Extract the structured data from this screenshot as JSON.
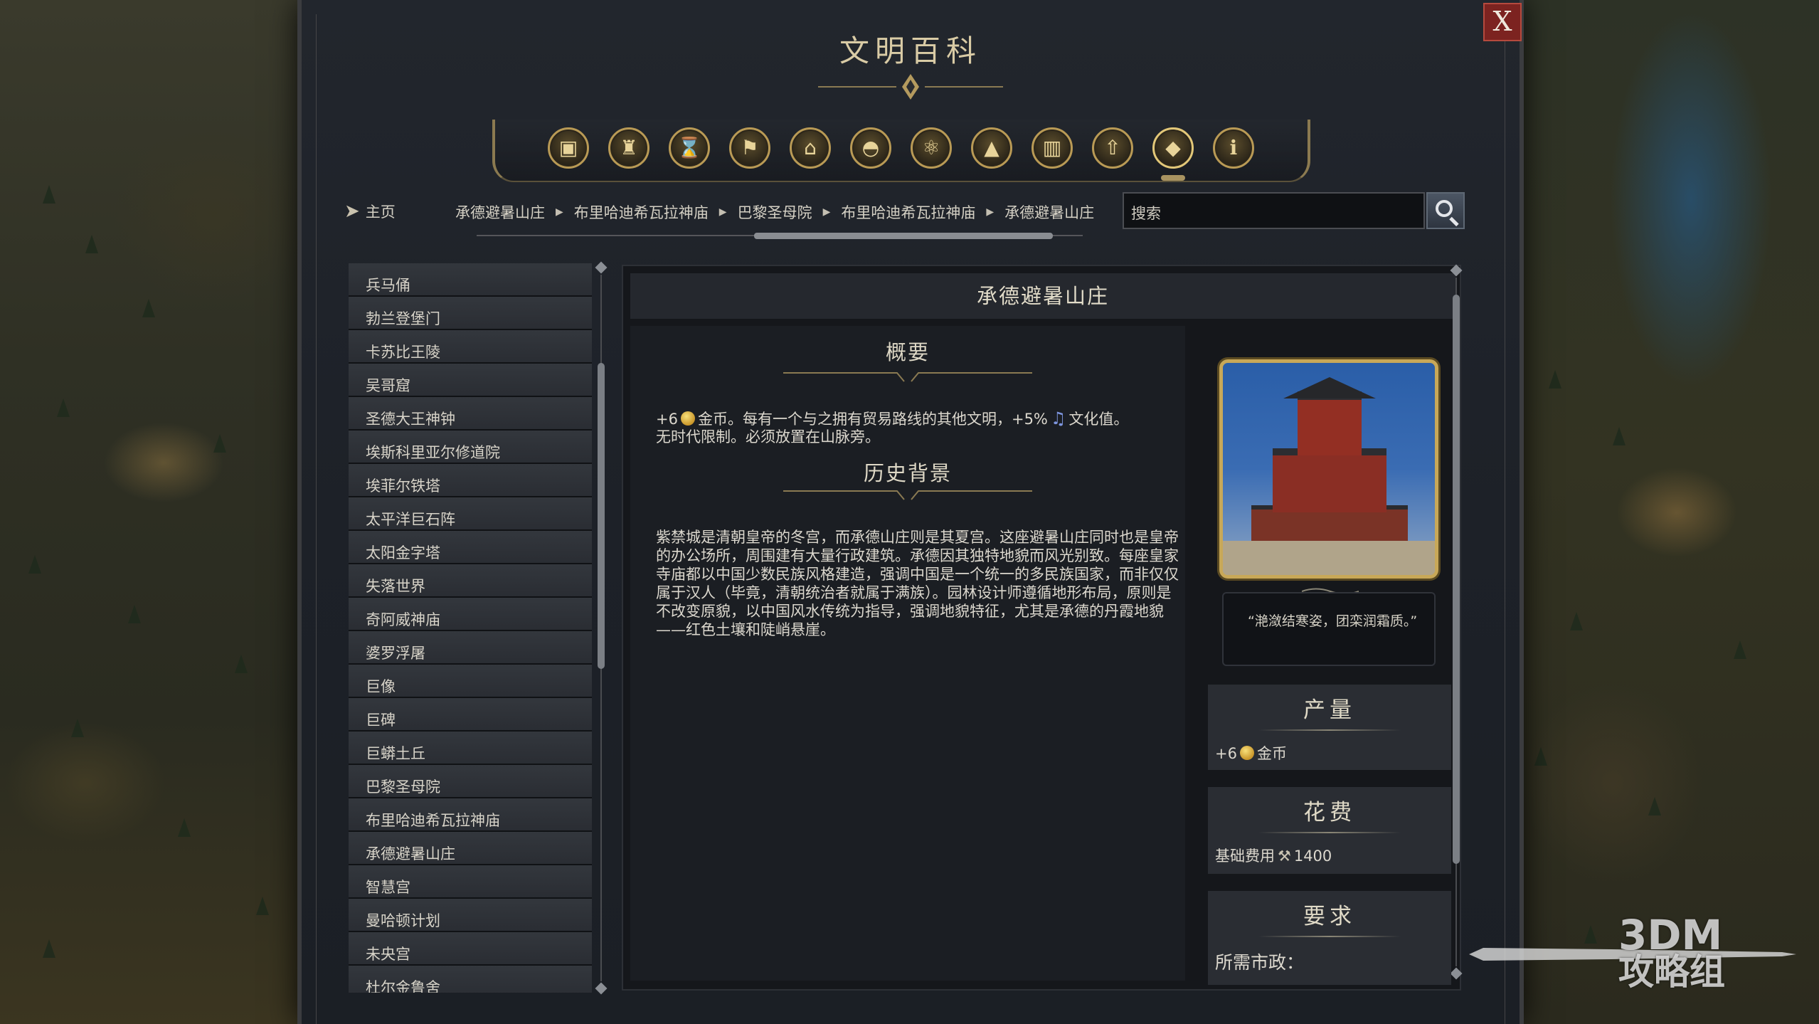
{
  "window": {
    "title": "文明百科",
    "close_label": "X"
  },
  "toolbar": {
    "icons": [
      {
        "name": "resources-icon",
        "glyph": "▣"
      },
      {
        "name": "goblet-icon",
        "glyph": "♜"
      },
      {
        "name": "hourglass-icon",
        "glyph": "⌛"
      },
      {
        "name": "flag-icon",
        "glyph": "⚑"
      },
      {
        "name": "temple-icon",
        "glyph": "⌂"
      },
      {
        "name": "dome-icon",
        "glyph": "◓"
      },
      {
        "name": "atom-icon",
        "glyph": "⚛"
      },
      {
        "name": "mountains-icon",
        "glyph": "▲"
      },
      {
        "name": "buildings-icon",
        "glyph": "▥"
      },
      {
        "name": "upgrade-icon",
        "glyph": "⇧"
      },
      {
        "name": "wonder-icon",
        "glyph": "◆"
      },
      {
        "name": "info-icon",
        "glyph": "ℹ"
      }
    ],
    "active_index": 10
  },
  "nav": {
    "home_label": "主页",
    "breadcrumbs": [
      "承德避暑山庄",
      "布里哈迪希瓦拉神庙",
      "巴黎圣母院",
      "布里哈迪希瓦拉神庙",
      "承德避暑山庄"
    ],
    "search_placeholder": "搜索"
  },
  "list": {
    "items": [
      "兵马俑",
      "勃兰登堡门",
      "卡苏比王陵",
      "吴哥窟",
      "圣德大王神钟",
      "埃斯科里亚尔修道院",
      "埃菲尔铁塔",
      "太平洋巨石阵",
      "太阳金字塔",
      "失落世界",
      "奇阿威神庙",
      "婆罗浮屠",
      "巨像",
      "巨碑",
      "巨蟒土丘",
      "巴黎圣母院",
      "布里哈迪希瓦拉神庙",
      "承德避暑山庄",
      "智慧宫",
      "曼哈顿计划",
      "未央宫",
      "杜尔金鲁舍"
    ]
  },
  "detail": {
    "title": "承德避暑山庄",
    "overview_heading": "概要",
    "overview": {
      "prefix": "+6",
      "gold_label": "金币。每有一个与之拥有贸易路线的其他文明，+5%",
      "culture_label": "文化值。",
      "line2": "无时代限制。必须放置在山脉旁。"
    },
    "history_heading": "历史背景",
    "history_text": "紫禁城是清朝皇帝的冬宫，而承德山庄则是其夏宫。这座避暑山庄同时也是皇帝的办公场所，周围建有大量行政建筑。承德因其独特地貌而风光别致。每座皇家寺庙都以中国少数民族风格建造，强调中国是一个统一的多民族国家，而非仅仅属于汉人（毕竟，清朝统治者就属于满族）。园林设计师遵循地形布局，原则是不改变原貌，以中国风水传统为指导，强调地貌特征，尤其是承德的丹霞地貌——红色土壤和陡峭悬崖。",
    "quote": "“滟潋结寒姿，团栾润霜质。”",
    "yield": {
      "heading": "产量",
      "prefix": "+6",
      "label": "金币"
    },
    "cost": {
      "heading": "花费",
      "label": "基础费用",
      "value": "1400"
    },
    "requirements": {
      "heading": "要求",
      "label": "所需市政："
    }
  },
  "watermark": {
    "line1": "3DM",
    "line2": "攻略组"
  },
  "colors": {
    "gold": "#c8a858",
    "close_red": "#7c2320",
    "panel_bg": "#1d2128"
  }
}
